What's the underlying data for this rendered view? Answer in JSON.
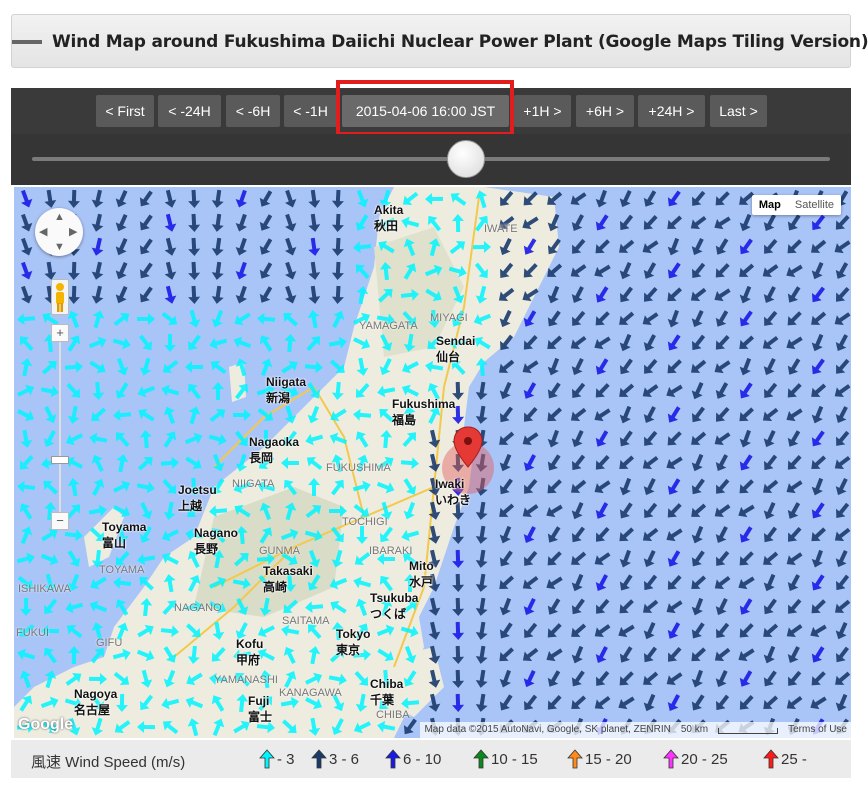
{
  "title": "Wind Map around Fukushima Daiichi Nuclear Power Plant (Google Maps Tiling Version)",
  "nav": {
    "first": "< First",
    "minus24": "< -24H",
    "minus6": "< -6H",
    "minus1": "< -1H",
    "date": "2015-04-06 16:00 JST",
    "plus1": "+1H >",
    "plus6": "+6H >",
    "plus24": "+24H >",
    "last": "Last >"
  },
  "map": {
    "type_map": "Map",
    "type_satellite": "Satellite",
    "zoom_in": "+",
    "zoom_out": "−",
    "logo": "Google",
    "attribution": "Map data ©2015 AutoNavi, Google, SK planet, ZENRIN",
    "scale": "50 km",
    "terms": "Terms of Use",
    "cities": [
      {
        "name": "Akita",
        "sub": "秋田"
      },
      {
        "name": "IWATE"
      },
      {
        "name": "YAMAGATA"
      },
      {
        "name": "MIYAGI"
      },
      {
        "name": "Sendai",
        "sub": "仙台"
      },
      {
        "name": "Niigata",
        "sub": "新潟"
      },
      {
        "name": "Fukushima",
        "sub": "福島"
      },
      {
        "name": "Nagaoka",
        "sub": "長岡"
      },
      {
        "name": "FUKUSHIMA"
      },
      {
        "name": "Iwaki",
        "sub": "いわき"
      },
      {
        "name": "Joetsu",
        "sub": "上越"
      },
      {
        "name": "NIIGATA"
      },
      {
        "name": "TOCHIGI"
      },
      {
        "name": "Toyama",
        "sub": "富山"
      },
      {
        "name": "Nagano",
        "sub": "長野"
      },
      {
        "name": "GUNMA"
      },
      {
        "name": "IBARAKI"
      },
      {
        "name": "Mito",
        "sub": "水戸"
      },
      {
        "name": "TOYAMA"
      },
      {
        "name": "Takasaki",
        "sub": "高崎"
      },
      {
        "name": "Tsukuba",
        "sub": "つくば"
      },
      {
        "name": "ISHIKAWA"
      },
      {
        "name": "NAGANO"
      },
      {
        "name": "FUKUI"
      },
      {
        "name": "GIFU"
      },
      {
        "name": "SAITAMA"
      },
      {
        "name": "Tokyo",
        "sub": "東京"
      },
      {
        "name": "Kofu",
        "sub": "甲府"
      },
      {
        "name": "Nagoya",
        "sub": "名古屋"
      },
      {
        "name": "YAMANASHI"
      },
      {
        "name": "Chiba",
        "sub": "千葉"
      },
      {
        "name": "Fuji",
        "sub": "富士"
      },
      {
        "name": "KANAGAWA"
      },
      {
        "name": "CHIBA"
      }
    ]
  },
  "legend": {
    "label": "風速 Wind Speed (m/s)",
    "items": [
      {
        "range": "- 3",
        "color": "#00f5ff"
      },
      {
        "range": "3 - 6",
        "color": "#1a3a6b"
      },
      {
        "range": "6 - 10",
        "color": "#1a1ae6"
      },
      {
        "range": "10 - 15",
        "color": "#0a8a1e"
      },
      {
        "range": "15 - 20",
        "color": "#ff8c1a"
      },
      {
        "range": "20 - 25",
        "color": "#ff33ff"
      },
      {
        "range": "25 -",
        "color": "#ff1a1a"
      }
    ]
  }
}
